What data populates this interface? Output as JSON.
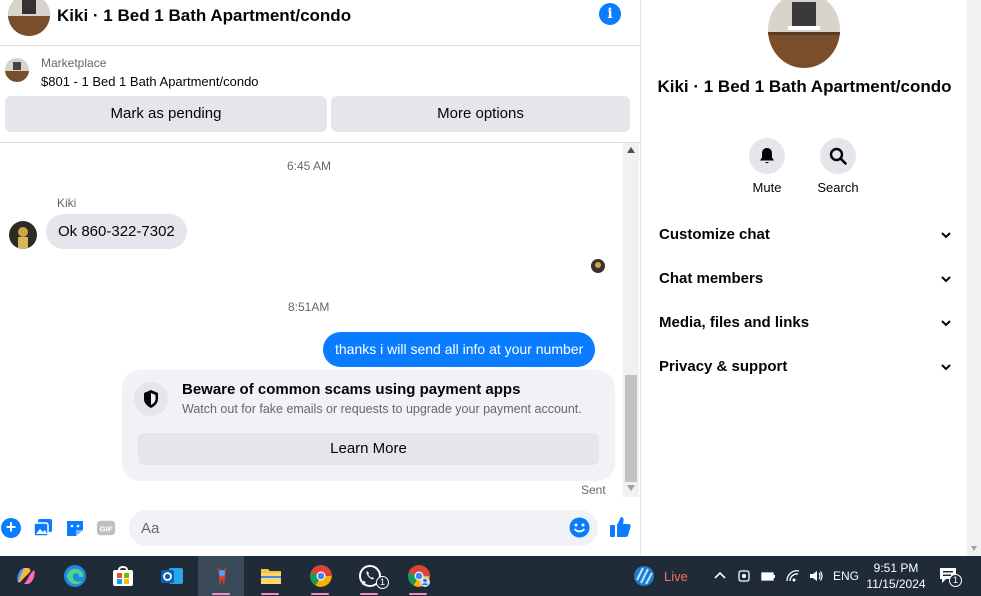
{
  "chat": {
    "header_title": "Kiki · 1 Bed 1 Bath Apartment/condo",
    "listing": {
      "kicker": "Marketplace",
      "title": "$801 - 1 Bed 1 Bath Apartment/condo",
      "mark_pending_label": "Mark as pending",
      "more_options_label": "More options"
    },
    "messages": {
      "timestamp_1": "6:45 AM",
      "sender_name": "Kiki",
      "incoming_text": "Ok 860-322-7302",
      "timestamp_2": "8:51AM",
      "outgoing_text": "thanks i will send all info at your number",
      "scam_title": "Beware of common scams using payment apps",
      "scam_body": "Watch out for fake emails or requests to upgrade your payment account.",
      "learn_more_label": "Learn More",
      "sent_label": "Sent"
    },
    "composer": {
      "placeholder": "Aa"
    }
  },
  "details": {
    "title": "Kiki · 1 Bed 1 Bath Apartment/condo",
    "mute_label": "Mute",
    "search_label": "Search",
    "sections": [
      "Customize chat",
      "Chat members",
      "Media, files and links",
      "Privacy & support"
    ]
  },
  "taskbar": {
    "whatsapp_badge": "1",
    "live_label": "Live",
    "language": "ENG",
    "time": "9:51 PM",
    "date": "11/15/2024",
    "notification_count": "1"
  },
  "colors": {
    "accent": "#0a7cff",
    "bubble_incoming": "#e4e6eb",
    "taskbar": "#1f2c38",
    "live_text": "#ff6b5c"
  },
  "icons": [
    "info-icon",
    "shield-icon",
    "plus-icon",
    "image-icon",
    "sticker-icon",
    "gif-icon",
    "emoji-icon",
    "like-icon",
    "bell-icon",
    "search-icon",
    "chevron-down-icon"
  ]
}
